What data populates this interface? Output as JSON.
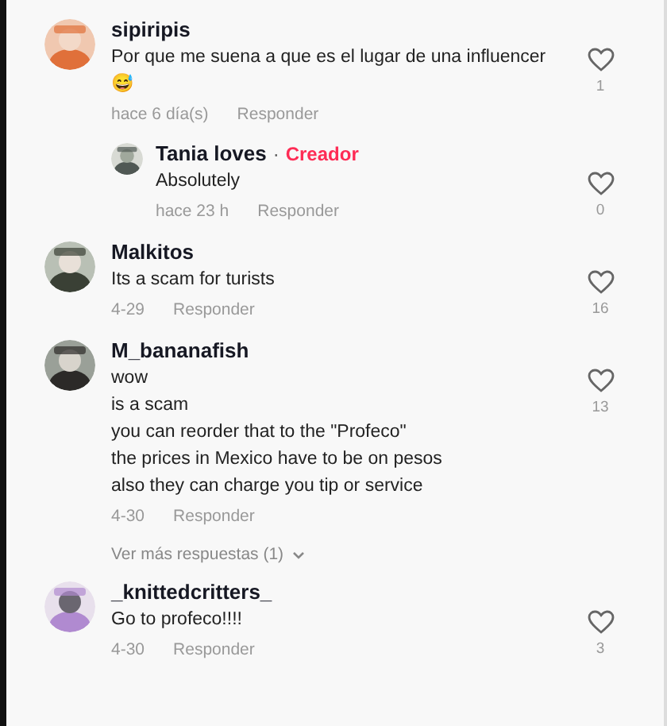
{
  "comments": [
    {
      "username": "sipiripis",
      "lines": [
        "Por que me suena a que es el lugar de una influencer",
        "😅"
      ],
      "time": "hace 6 día(s)",
      "reply_label": "Responder",
      "likes": "1",
      "liked": false,
      "replies": [
        {
          "username": "Tania loves",
          "separator": "·",
          "creator_label": "Creador",
          "lines": [
            "Absolutely"
          ],
          "time": "hace 23 h",
          "reply_label": "Responder",
          "likes": "0",
          "liked": false
        }
      ]
    },
    {
      "username": "Malkitos",
      "lines": [
        "Its a scam for turists"
      ],
      "time": "4-29",
      "reply_label": "Responder",
      "likes": "16",
      "liked": false
    },
    {
      "username": "M_bananafish",
      "lines": [
        "wow",
        "is a scam",
        "you can reorder that to the \"Profeco\"",
        "the prices in Mexico have to be on pesos",
        "also they can charge you tip or service"
      ],
      "time": "4-30",
      "reply_label": "Responder",
      "likes": "13",
      "liked": false,
      "more_replies": "Ver más respuestas (1)"
    },
    {
      "username": "_knittedcritters_",
      "lines": [
        "Go to profeco!!!!"
      ],
      "time": "4-30",
      "reply_label": "Responder",
      "likes": "3",
      "liked": false
    }
  ]
}
